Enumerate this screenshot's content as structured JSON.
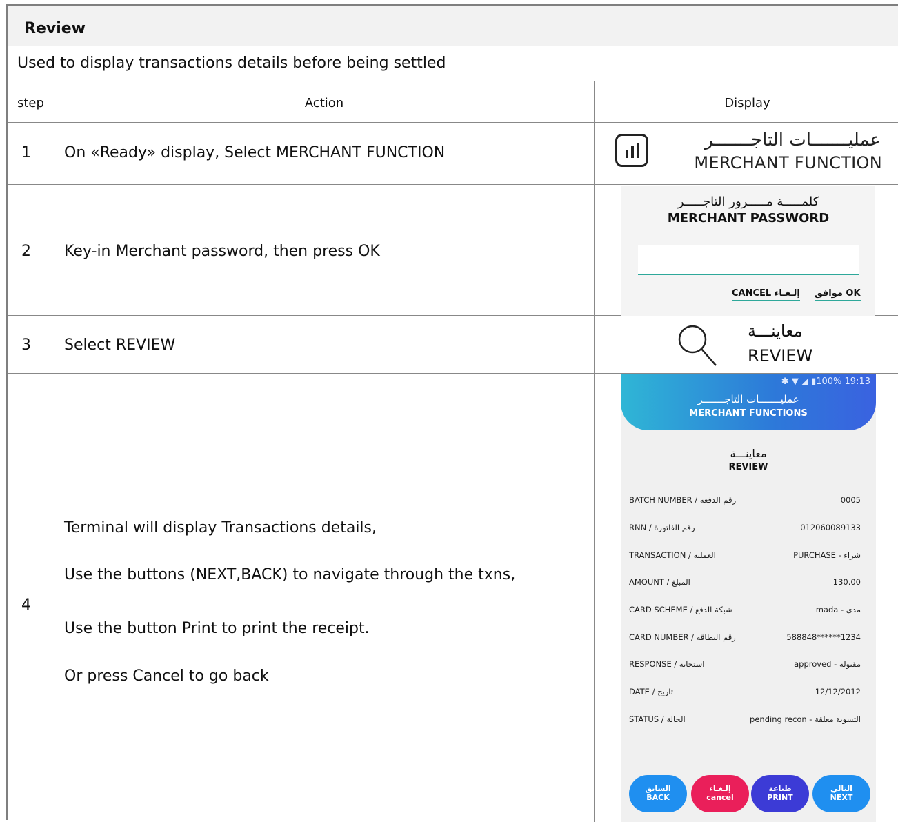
{
  "title": "Review",
  "description": "Used to display transactions details before being settled",
  "headers": {
    "step": "step",
    "action": "Action",
    "display": "Display"
  },
  "steps": [
    {
      "num": "1",
      "action": "On «Ready» display, Select MERCHANT FUNCTION"
    },
    {
      "num": "2",
      "action": "Key-in Merchant password, then press OK"
    },
    {
      "num": "3",
      "action": "Select REVIEW"
    },
    {
      "num": "4",
      "lines": [
        "Terminal will display Transactions details,",
        "Use the buttons (NEXT,BACK) to navigate through the txns,",
        "Use the button Print to print the receipt.",
        "Or press Cancel to go back"
      ]
    }
  ],
  "merchant_function": {
    "ar": "عمليـــــــات التاجـــــــر",
    "en": "MERCHANT FUNCTION",
    "icon": "bar-chart-icon"
  },
  "password_screen": {
    "ar": "كلمـــــة مـــــرور التاجـــــر",
    "en": "MERCHANT PASSWORD",
    "cancel": "CANCEL إلـغـاء",
    "ok": "موافق OK"
  },
  "review_item": {
    "ar": "معاينـــة",
    "en": "REVIEW",
    "icon": "search-icon"
  },
  "phone": {
    "status_bar": "✱ ▼ ◢ ▮100%  19:13",
    "header_ar": "عمليـــــــات التاجـــــــر",
    "header_en": "MERCHANT FUNCTIONS",
    "review_ar": "معاينـــة",
    "review_en": "REVIEW",
    "details": [
      {
        "label": "BATCH NUMBER / رقم الدفعة",
        "value": "0005"
      },
      {
        "label": "RNN / رقم الفاتورة",
        "value": "012060089133"
      },
      {
        "label": "TRANSACTION / العملية",
        "value": "PURCHASE - شراء"
      },
      {
        "label": "AMOUNT / المبلغ",
        "value": "130.00"
      },
      {
        "label": "CARD SCHEME / شبكة الدفع",
        "value": "mada - مدى"
      },
      {
        "label": "CARD NUMBER / رقم البطاقة",
        "value": "588848******1234"
      },
      {
        "label": "RESPONSE / استجابة",
        "value": "approved - مقبولة"
      },
      {
        "label": "DATE / تاريخ",
        "value": "12/12/2012"
      },
      {
        "label": "STATUS / الحالة",
        "value": "pending recon - التسوية معلقة"
      }
    ],
    "buttons": [
      {
        "ar": "السابق",
        "en": "BACK"
      },
      {
        "ar": "إلـغـاء",
        "en": "cancel"
      },
      {
        "ar": "طباعة",
        "en": "PRINT"
      },
      {
        "ar": "التالي",
        "en": "NEXT"
      }
    ]
  }
}
